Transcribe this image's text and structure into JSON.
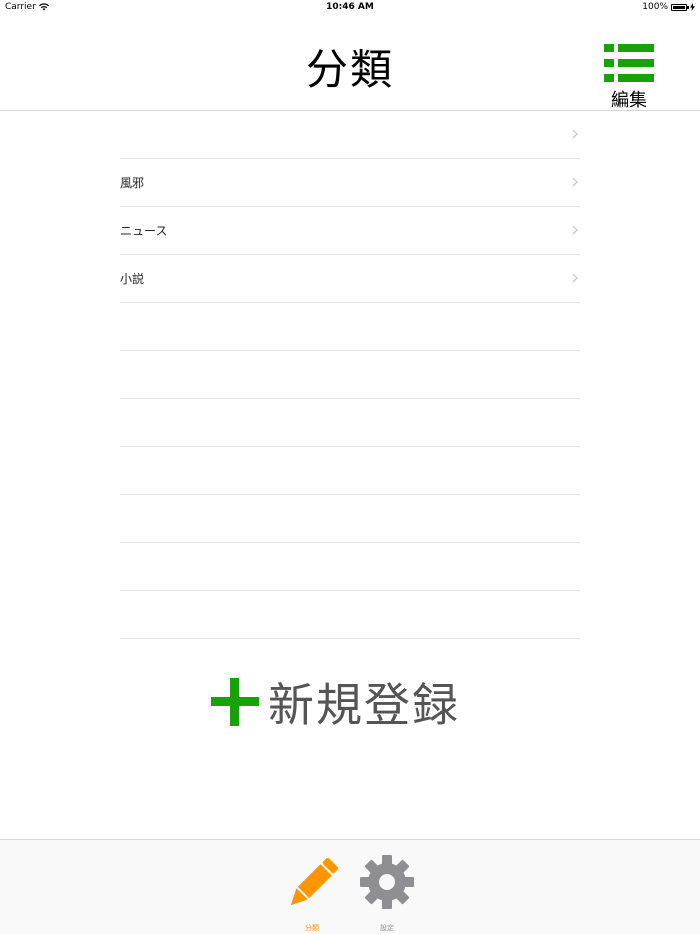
{
  "status_bar": {
    "carrier": "Carrier",
    "time": "10:46 AM",
    "battery": "100%",
    "battery_level": 1.0
  },
  "nav": {
    "title": "分類",
    "edit_label": "編集",
    "accent": "#1aa10a"
  },
  "table": {
    "rows": [
      {
        "label": ""
      },
      {
        "label": "風邪"
      },
      {
        "label": "ニュース"
      },
      {
        "label": "小説"
      }
    ],
    "empty_rows": 7
  },
  "new_button": {
    "label": "新規登録",
    "icon": "plus-icon",
    "icon_color": "#1aa10a"
  },
  "tab_bar": {
    "tabs": [
      {
        "label": "分類",
        "icon": "pencil-icon",
        "selected": true,
        "color": "#ff9500"
      },
      {
        "label": "設定",
        "icon": "gear-icon",
        "selected": false,
        "color": "#8e8e93"
      }
    ]
  }
}
